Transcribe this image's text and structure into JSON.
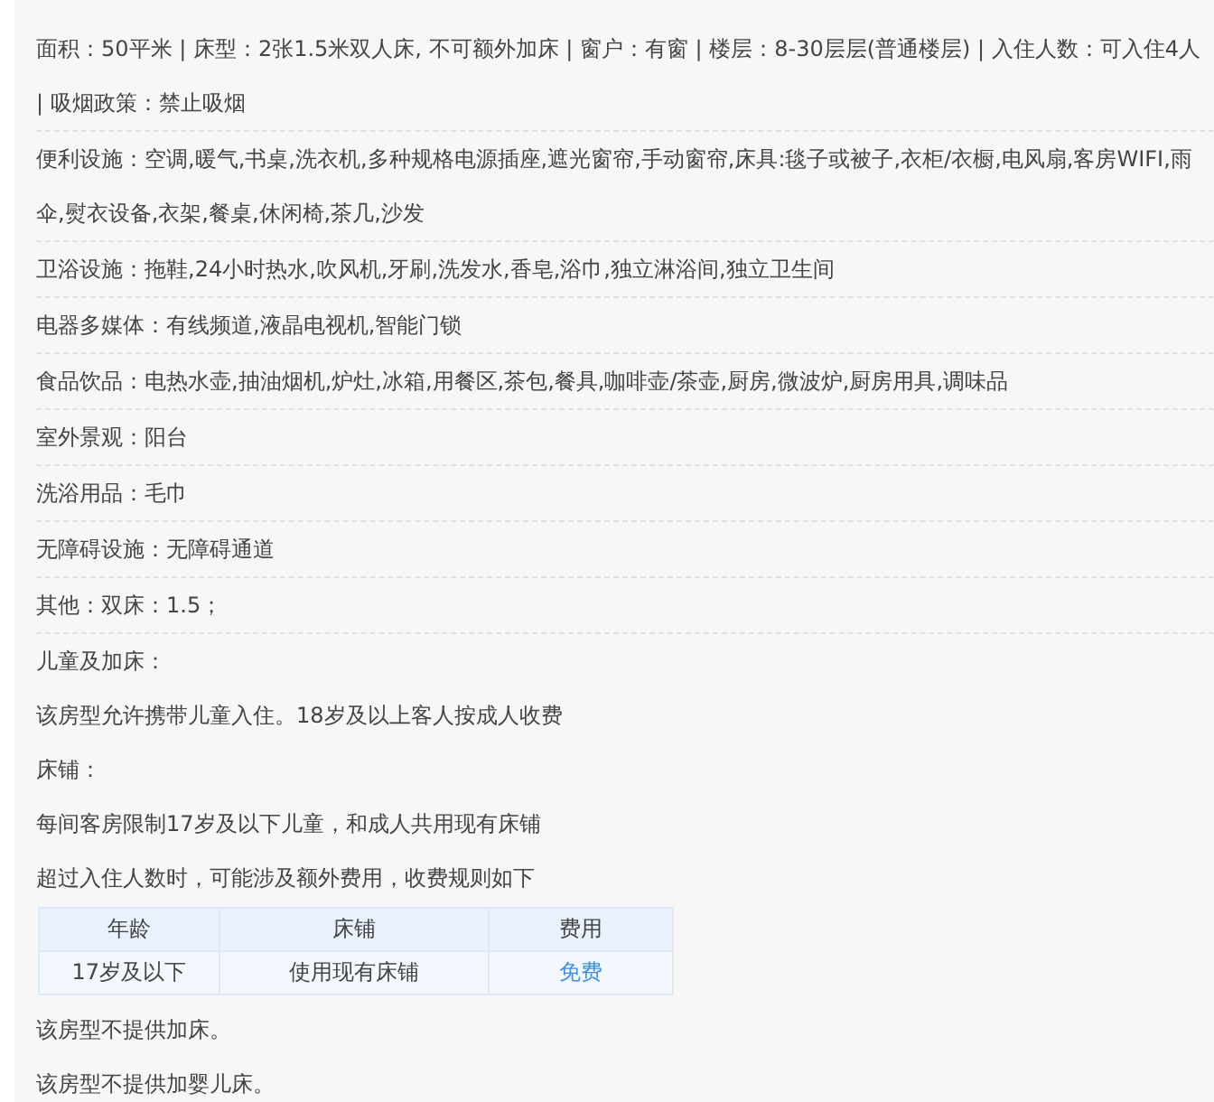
{
  "details": [
    {
      "text": "面积：50平米 | 床型：2张1.5米双人床, 不可额外加床 | 窗户：有窗 | 楼层：8-30层层(普通楼层) | 入住人数：可入住4人 | 吸烟政策：禁止吸烟"
    },
    {
      "text": "便利设施：空调,暖气,书桌,洗衣机,多种规格电源插座,遮光窗帘,手动窗帘,床具:毯子或被子,衣柜/衣橱,电风扇,客房WIFI,雨伞,熨衣设备,衣架,餐桌,休闲椅,茶几,沙发"
    },
    {
      "text": "卫浴设施：拖鞋,24小时热水,吹风机,牙刷,洗发水,香皂,浴巾,独立淋浴间,独立卫生间"
    },
    {
      "text": "电器多媒体：有线频道,液晶电视机,智能门锁"
    },
    {
      "text": "食品饮品：电热水壶,抽油烟机,炉灶,冰箱,用餐区,茶包,餐具,咖啡壶/茶壶,厨房,微波炉,厨房用具,调味品"
    },
    {
      "text": "室外景观：阳台"
    },
    {
      "text": "洗浴用品：毛巾"
    },
    {
      "text": "无障碍设施：无障碍通道"
    },
    {
      "text": "其他：双床：1.5；"
    }
  ],
  "policy": {
    "title": "儿童及加床：",
    "lines": [
      "该房型允许携带儿童入住。18岁及以上客人按成人收费"
    ],
    "bed_title": "床铺：",
    "bed_lines": [
      "每间客房限制17岁及以下儿童，和成人共用现有床铺",
      "超过入住人数时，可能涉及额外费用，收费规则如下"
    ],
    "table": {
      "columns": [
        "年龄",
        "床铺",
        "费用"
      ],
      "rows": [
        [
          "17岁及以下",
          "使用现有床铺",
          "免费"
        ]
      ]
    },
    "notes": [
      "该房型不提供加床。",
      "该房型不提供加婴儿床。"
    ]
  }
}
